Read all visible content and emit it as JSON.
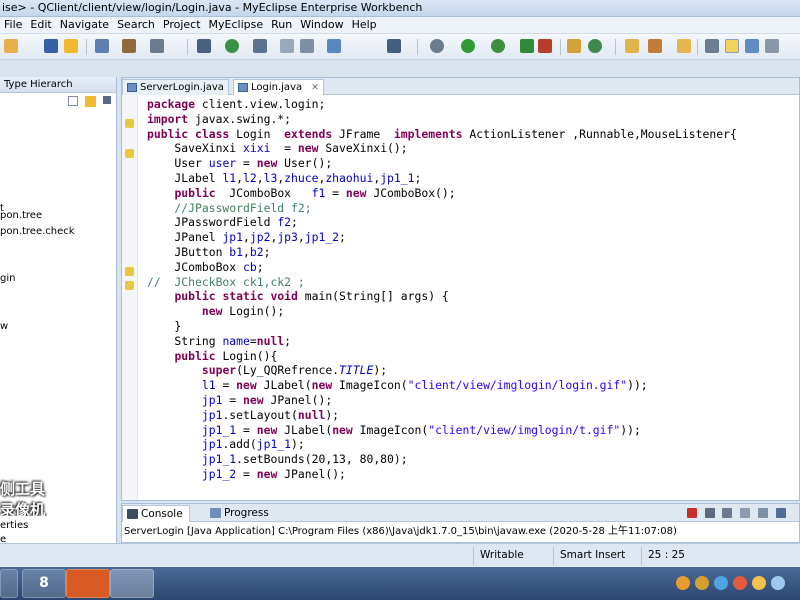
{
  "window": {
    "title": "ise> - QClient/client/view/login/Login.java - MyEclipse Enterprise Workbench"
  },
  "menu": [
    "File",
    "Edit",
    "Navigate",
    "Search",
    "Project",
    "MyEclipse",
    "Run",
    "Window",
    "Help"
  ],
  "toolbar": {
    "icons": [
      "new-icon",
      "save-icon",
      "print-icon",
      "package-icon",
      "web-project-icon",
      "deploy-icon",
      "server-icon",
      "globe-icon",
      "wrench-icon",
      "edit-icon",
      "image-icon",
      "browser-icon",
      "debug-icon",
      "run-icon",
      "external-tools-icon",
      "new-class-icon",
      "search-icon",
      "open-type-icon",
      "back-icon",
      "forward-icon",
      "perspective-icon",
      "myeclipse-perspective-icon"
    ]
  },
  "left_panel": {
    "tab_label": "Type Hierarch",
    "items": [
      "t",
      "pon.tree",
      "pon.tree.check",
      "gin",
      "w",
      "erties",
      "e"
    ]
  },
  "editor": {
    "tabs": [
      {
        "label": "ServerLogin.java",
        "active": false
      },
      {
        "label": "Login.java",
        "active": true
      }
    ],
    "lines": [
      [
        [
          "kw",
          "package"
        ],
        [
          "",
          " client.view.login;"
        ]
      ],
      [
        [
          "kw",
          "import"
        ],
        [
          "",
          " javax.swing.*;"
        ]
      ],
      [
        [
          "kw",
          "public class"
        ],
        [
          "",
          " Login  "
        ],
        [
          "kw",
          "extends"
        ],
        [
          "",
          " JFrame  "
        ],
        [
          "kw",
          "implements"
        ],
        [
          "",
          " ActionListener ,Runnable,MouseListener{"
        ]
      ],
      [
        [
          "",
          "    SaveXinxi "
        ],
        [
          "vr",
          "xixi"
        ],
        [
          "",
          "  = "
        ],
        [
          "kw",
          "new"
        ],
        [
          "",
          " SaveXinxi();"
        ]
      ],
      [
        [
          "",
          "    User "
        ],
        [
          "vr",
          "user"
        ],
        [
          "",
          " = "
        ],
        [
          "kw",
          "new"
        ],
        [
          "",
          " User();"
        ]
      ],
      [
        [
          "",
          "    JLabel "
        ],
        [
          "vr",
          "l1"
        ],
        [
          "",
          ","
        ],
        [
          "vr",
          "l2"
        ],
        [
          "",
          ","
        ],
        [
          "vr",
          "l3"
        ],
        [
          "",
          ","
        ],
        [
          "vr",
          "zhuce"
        ],
        [
          "",
          ","
        ],
        [
          "vr",
          "zhaohui"
        ],
        [
          "",
          ","
        ],
        [
          "vr",
          "jp1_1"
        ],
        [
          "",
          ";"
        ]
      ],
      [
        [
          "",
          "    "
        ],
        [
          "kw",
          "public"
        ],
        [
          "",
          "  JComboBox   "
        ],
        [
          "vr",
          "f1"
        ],
        [
          "",
          " = "
        ],
        [
          "kw",
          "new"
        ],
        [
          "",
          " JComboBox();"
        ]
      ],
      [
        [
          "cm",
          "    //JPasswordField f2;"
        ]
      ],
      [
        [
          "",
          "    JPasswordField "
        ],
        [
          "vr",
          "f2"
        ],
        [
          "",
          ";"
        ]
      ],
      [
        [
          "",
          "    JPanel "
        ],
        [
          "vr",
          "jp1"
        ],
        [
          "",
          ","
        ],
        [
          "vr",
          "jp2"
        ],
        [
          "",
          ","
        ],
        [
          "vr",
          "jp3"
        ],
        [
          "",
          ","
        ],
        [
          "vr",
          "jp1_2"
        ],
        [
          "",
          ";"
        ]
      ],
      [
        [
          "",
          "    JButton "
        ],
        [
          "vr",
          "b1"
        ],
        [
          "",
          ","
        ],
        [
          "vr",
          "b2"
        ],
        [
          "",
          ";"
        ]
      ],
      [
        [
          "",
          "    JComboBox "
        ],
        [
          "vr",
          "cb"
        ],
        [
          "",
          ";"
        ]
      ],
      [
        [
          "cm",
          "//  JCheckBox ck1,ck2 ;"
        ]
      ],
      [
        [
          "",
          "    "
        ],
        [
          "kw",
          "public static void"
        ],
        [
          "",
          " main(String[] args) {"
        ]
      ],
      [
        [
          "",
          "        "
        ],
        [
          "kw",
          "new"
        ],
        [
          "",
          " Login();"
        ]
      ],
      [
        [
          "",
          "    }"
        ]
      ],
      [
        [
          "",
          "    String "
        ],
        [
          "vr",
          "name"
        ],
        [
          "",
          "="
        ],
        [
          "kw",
          "null"
        ],
        [
          "",
          ";"
        ]
      ],
      [
        [
          "",
          "    "
        ],
        [
          "kw",
          "public"
        ],
        [
          "",
          " Login(){"
        ]
      ],
      [
        [
          "",
          "        "
        ],
        [
          "kw",
          "super"
        ],
        [
          "",
          "(Ly_QQRefrence."
        ],
        [
          "it",
          "TITLE"
        ],
        [
          "",
          ");"
        ]
      ],
      [
        [
          "",
          "        "
        ],
        [
          "vr",
          "l1"
        ],
        [
          "",
          " = "
        ],
        [
          "kw",
          "new"
        ],
        [
          "",
          " JLabel("
        ],
        [
          "kw",
          "new"
        ],
        [
          "",
          " ImageIcon("
        ],
        [
          "st",
          "\"client/view/imglogin/login.gif\""
        ],
        [
          "",
          "));"
        ]
      ],
      [
        [
          "",
          "        "
        ],
        [
          "vr",
          "jp1"
        ],
        [
          "",
          " = "
        ],
        [
          "kw",
          "new"
        ],
        [
          "",
          " JPanel();"
        ]
      ],
      [
        [
          "",
          "        "
        ],
        [
          "vr",
          "jp1"
        ],
        [
          "",
          ".setLayout("
        ],
        [
          "kw",
          "null"
        ],
        [
          "",
          ");"
        ]
      ],
      [
        [
          "",
          "        "
        ],
        [
          "vr",
          "jp1_1"
        ],
        [
          "",
          " = "
        ],
        [
          "kw",
          "new"
        ],
        [
          "",
          " JLabel("
        ],
        [
          "kw",
          "new"
        ],
        [
          "",
          " ImageIcon("
        ],
        [
          "st",
          "\"client/view/imglogin/t.gif\""
        ],
        [
          "",
          "));"
        ]
      ],
      [
        [
          "",
          "        "
        ],
        [
          "vr",
          "jp1"
        ],
        [
          "",
          ".add("
        ],
        [
          "vr",
          "jp1_1"
        ],
        [
          "",
          ");"
        ]
      ],
      [
        [
          "",
          "        "
        ],
        [
          "vr",
          "jp1_1"
        ],
        [
          "",
          ".setBounds(20,13, 80,80);"
        ]
      ],
      [
        [
          "",
          "        "
        ],
        [
          "vr",
          "jp1_2"
        ],
        [
          "",
          " = "
        ],
        [
          "kw",
          "new"
        ],
        [
          "",
          " JPanel();"
        ]
      ]
    ]
  },
  "console": {
    "tabs": [
      {
        "label": "Console",
        "active": true
      },
      {
        "label": "Progress",
        "active": false
      }
    ],
    "text": "ServerLogin [Java Application] C:\\Program Files (x86)\\Java\\jdk1.7.0_15\\bin\\javaw.exe (2020-5-28 上午11:07:08)"
  },
  "status": {
    "mode": "Writable",
    "insert": "Smart Insert",
    "position": "25 : 25"
  },
  "watermark": [
    "侧工具",
    "录像机"
  ],
  "taskbar": {
    "items": [
      "windows-explorer-icon",
      "eclipse-icon",
      "screen-recorder-icon",
      "java-icon"
    ]
  },
  "colors": {
    "keyword": "#7f0055",
    "field": "#0000c0",
    "string": "#2a00ff",
    "comment": "#3f7f5f"
  }
}
